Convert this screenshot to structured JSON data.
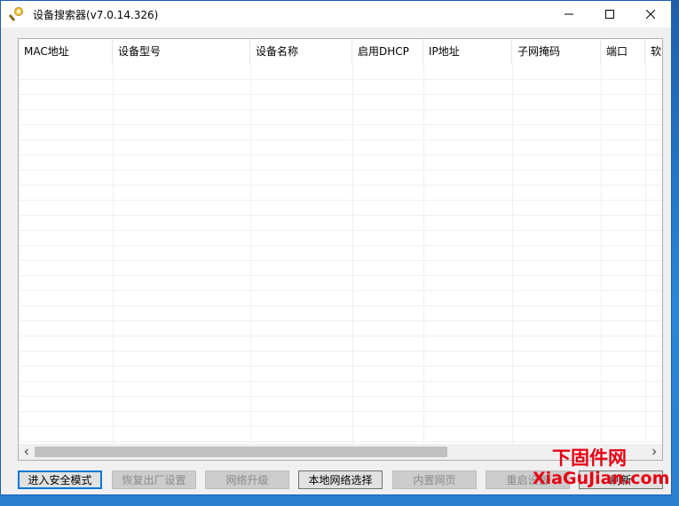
{
  "window": {
    "title": "设备搜索器(v7.0.14.326)"
  },
  "table": {
    "columns": [
      "MAC地址",
      "设备型号",
      "设备名称",
      "启用DHCP",
      "IP地址",
      "子网掩码",
      "端口",
      "软"
    ]
  },
  "buttons": [
    {
      "label": "进入安全模式",
      "enabled": true
    },
    {
      "label": "恢复出厂设置",
      "enabled": false
    },
    {
      "label": "网络升级",
      "enabled": false
    },
    {
      "label": "本地网络选择",
      "enabled": true
    },
    {
      "label": "内置网页",
      "enabled": false
    },
    {
      "label": "重启设备",
      "enabled": false
    },
    {
      "label": "刷新",
      "enabled": true
    }
  ],
  "watermark": {
    "line1": "下固件网",
    "line2": "XiaGuJian.com"
  },
  "colors": {
    "titlebar_bg": "#ffffff",
    "window_bg": "#f0f0f0",
    "accent": "#0078d7",
    "watermark": "#e60012"
  }
}
